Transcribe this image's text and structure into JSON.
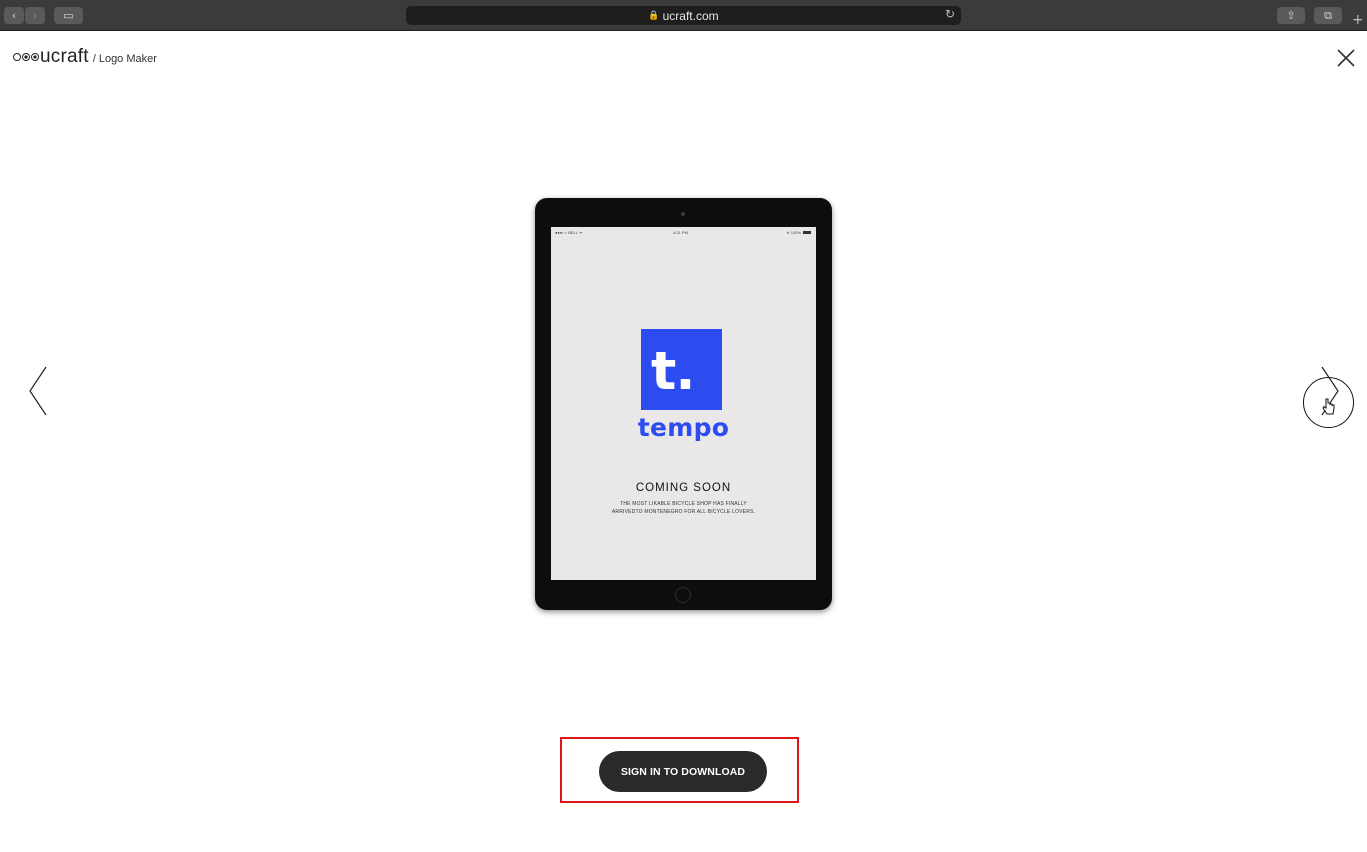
{
  "browser": {
    "back_glyph": "‹",
    "forward_glyph": "›",
    "sidebar_glyph": "▭",
    "lock_glyph": "🔒",
    "url": "ucraft.com",
    "reload_glyph": "↻",
    "share_glyph": "⇧",
    "tabs_glyph": "⧉",
    "newtab_glyph": "+"
  },
  "header": {
    "brand": "ucraft",
    "breadcrumb": "/ Logo Maker"
  },
  "preview": {
    "status_left": "●●●○○ BELL ᯤ",
    "status_time": "4:21 PM",
    "status_right": "∗ 100%",
    "logo_letter": "t.",
    "logo_name": "tempo",
    "heading": "COMING SOON",
    "description": "THE MOST LIKABLE BICYCLE SHOP HAS FINALLY ARRIVEDTO MONTENEGRO FOR ALL BICYCLE LOVERS."
  },
  "cta": {
    "label": "SIGN IN TO DOWNLOAD"
  },
  "colors": {
    "brand_blue": "#2d4cf0",
    "cta_bg": "#2a2a2a",
    "highlight_red": "#e0141b"
  }
}
